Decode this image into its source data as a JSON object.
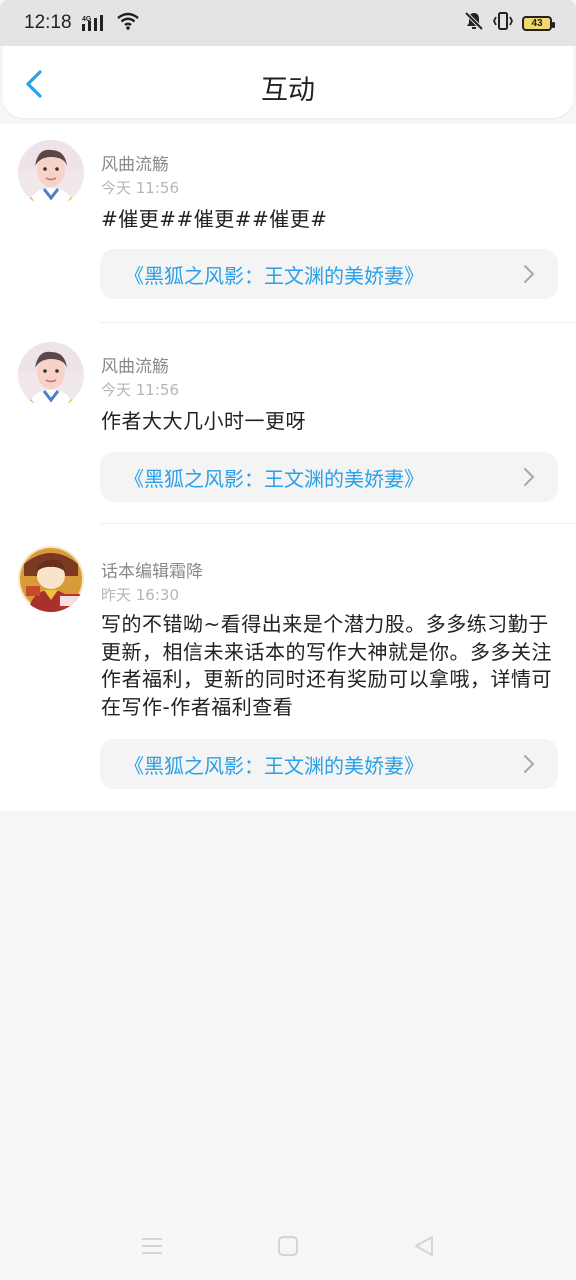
{
  "status_bar": {
    "time": "12:18",
    "network": "4G",
    "battery": "43",
    "icons": [
      "signal-icon",
      "wifi-icon",
      "mute-icon",
      "vibrate-icon",
      "battery-icon"
    ]
  },
  "header": {
    "title": "互动",
    "back_icon": "chevron-left-icon"
  },
  "accent_color": "#2aa0e6",
  "items": [
    {
      "name": "风曲流觞",
      "time": "今天 11:56",
      "content": "#催更##催更##催更#",
      "book": "《黑狐之风影：王文渊的美娇妻》"
    },
    {
      "name": "风曲流觞",
      "time": "今天 11:56",
      "content": "作者大大几小时一更呀",
      "book": "《黑狐之风影：王文渊的美娇妻》"
    },
    {
      "name": "话本编辑霜降",
      "time": "昨天 16:30",
      "content": "写的不错呦~看得出来是个潜力股。多多练习勤于更新，相信未来话本的写作大神就是你。多多关注作者福利，更新的同时还有奖励可以拿哦，详情可在写作-作者福利查看",
      "book": "《黑狐之风影：王文渊的美娇妻》"
    }
  ],
  "nav": {
    "icons": [
      "menu-icon",
      "home-icon",
      "back-icon"
    ]
  }
}
